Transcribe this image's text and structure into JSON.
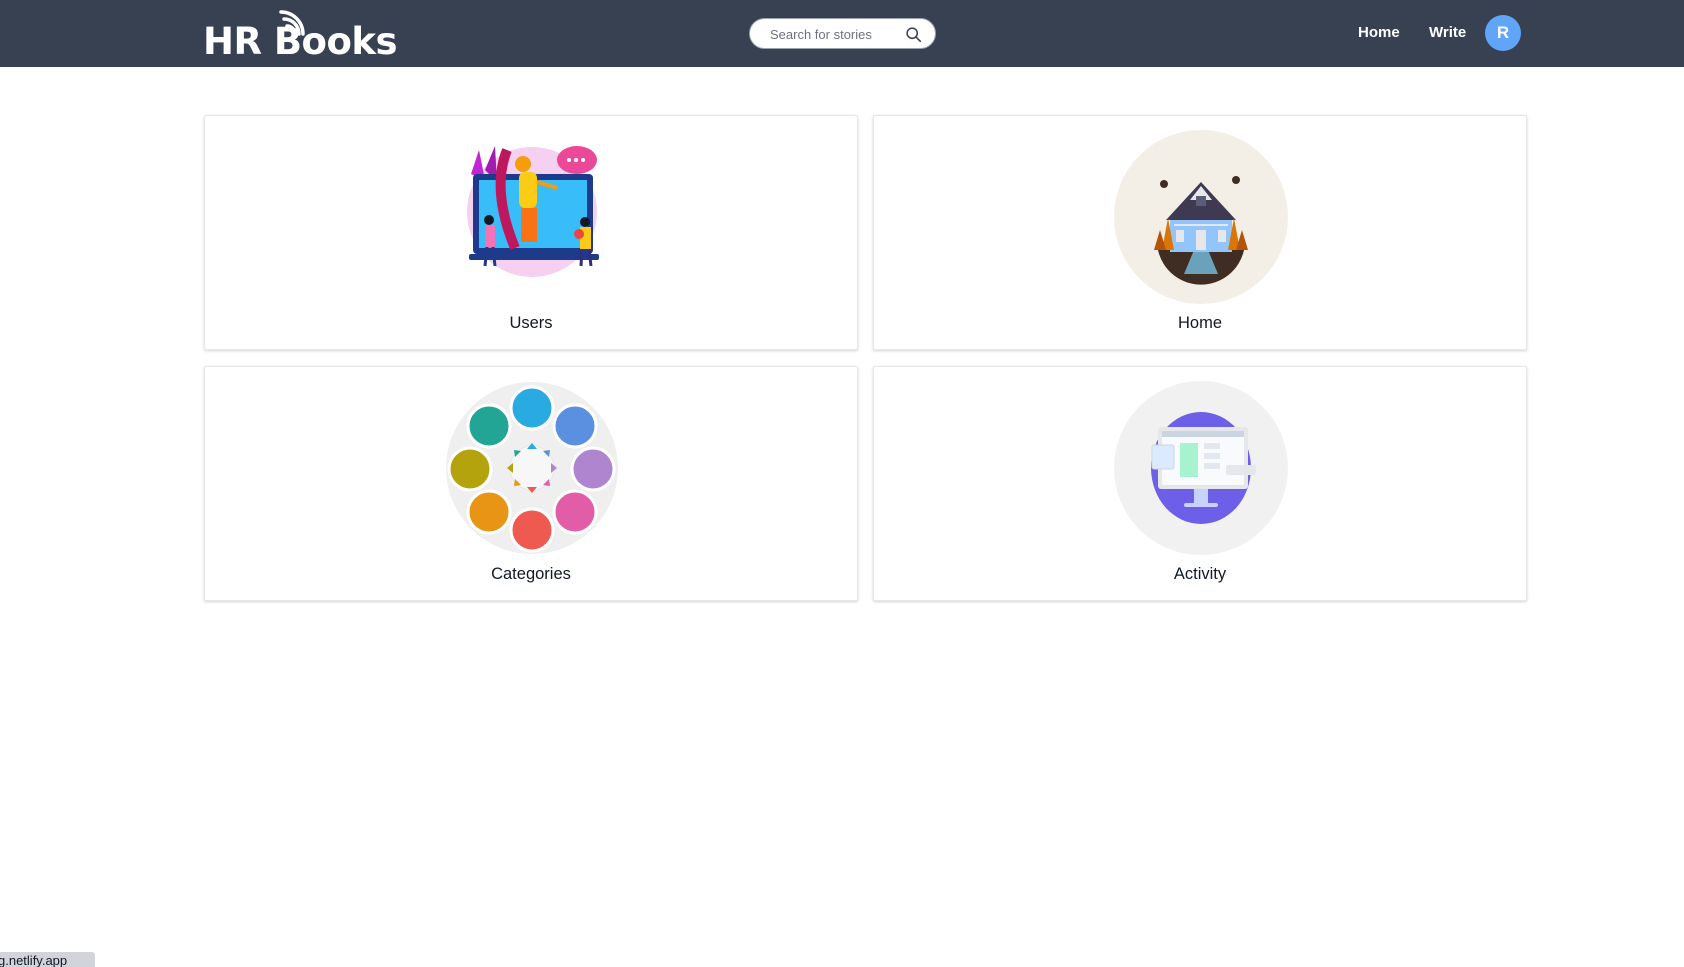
{
  "header": {
    "logo_text": "HR Books",
    "search_placeholder": "Search for stories",
    "nav": {
      "home": "Home",
      "write": "Write"
    },
    "avatar_initial": "R"
  },
  "cards": [
    {
      "label": "Users",
      "icon": "users-illustration"
    },
    {
      "label": "Home",
      "icon": "house-illustration"
    },
    {
      "label": "Categories",
      "icon": "categories-wheel-illustration"
    },
    {
      "label": "Activity",
      "icon": "activity-monitor-illustration"
    }
  ],
  "footer_badge": "g.netlify.app",
  "colors": {
    "navbar": "#374151",
    "avatar": "#60a5fa",
    "background": "#ffffff"
  }
}
